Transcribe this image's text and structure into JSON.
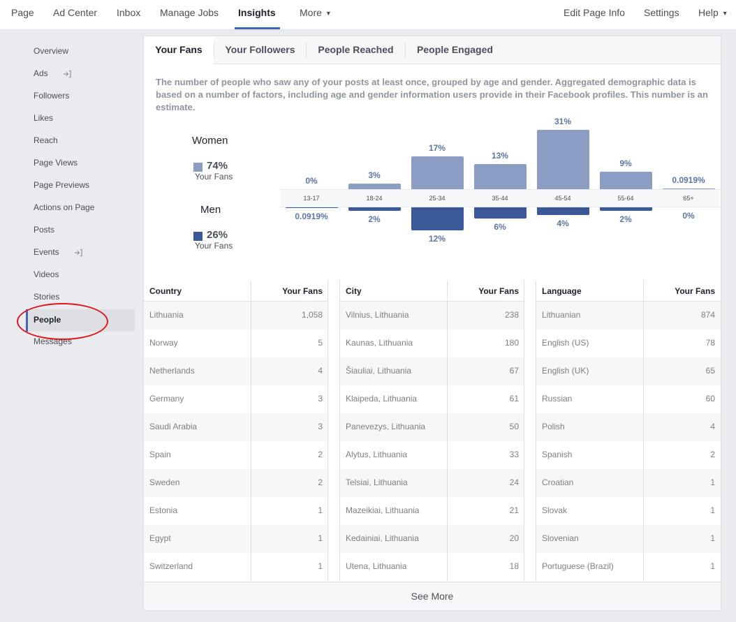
{
  "topnav": {
    "left": [
      "Page",
      "Ad Center",
      "Inbox",
      "Manage Jobs",
      "Insights",
      "More"
    ],
    "right": [
      "Edit Page Info",
      "Settings",
      "Help"
    ],
    "active": "Insights"
  },
  "sidebar": {
    "items": [
      {
        "label": "Overview"
      },
      {
        "label": "Ads",
        "icon": "export-icon"
      },
      {
        "label": "Followers"
      },
      {
        "label": "Likes"
      },
      {
        "label": "Reach"
      },
      {
        "label": "Page Views"
      },
      {
        "label": "Page Previews"
      },
      {
        "label": "Actions on Page"
      },
      {
        "label": "Posts"
      },
      {
        "label": "Events",
        "icon": "export-icon"
      },
      {
        "label": "Videos"
      },
      {
        "label": "Stories"
      },
      {
        "label": "People"
      },
      {
        "label": "Messages"
      }
    ],
    "active": "People"
  },
  "tabs": [
    "Your Fans",
    "Your Followers",
    "People Reached",
    "People Engaged"
  ],
  "description": "The number of people who saw any of your posts at least once, grouped by age and gender. Aggregated demographic data is based on a number of factors, including age and gender information users provide in their Facebook profiles. This number is an estimate.",
  "legend": {
    "women": {
      "label": "Women",
      "pct": "74%",
      "sub": "Your Fans",
      "color": "#8b9dc3"
    },
    "men": {
      "label": "Men",
      "pct": "26%",
      "sub": "Your Fans",
      "color": "#3b5998"
    }
  },
  "chart_data": {
    "type": "bar",
    "categories": [
      "13-17",
      "18-24",
      "25-34",
      "35-44",
      "45-54",
      "55-64",
      "65+"
    ],
    "series": [
      {
        "name": "Women",
        "values": [
          0,
          3,
          17,
          13,
          31,
          9,
          0.0919
        ],
        "labels": [
          "0%",
          "3%",
          "17%",
          "13%",
          "31%",
          "9%",
          "0.0919%"
        ],
        "color": "#8b9dc3"
      },
      {
        "name": "Men",
        "values": [
          0.0919,
          2,
          12,
          6,
          4,
          2,
          0
        ],
        "labels": [
          "0.0919%",
          "2%",
          "12%",
          "6%",
          "4%",
          "2%",
          "0%"
        ],
        "color": "#3b5998"
      }
    ]
  },
  "tables": [
    {
      "headers": [
        "Country",
        "Your Fans"
      ],
      "rows": [
        [
          "Lithuania",
          "1,058"
        ],
        [
          "Norway",
          "5"
        ],
        [
          "Netherlands",
          "4"
        ],
        [
          "Germany",
          "3"
        ],
        [
          "Saudi Arabia",
          "3"
        ],
        [
          "Spain",
          "2"
        ],
        [
          "Sweden",
          "2"
        ],
        [
          "Estonia",
          "1"
        ],
        [
          "Egypt",
          "1"
        ],
        [
          "Switzerland",
          "1"
        ]
      ]
    },
    {
      "headers": [
        "City",
        "Your Fans"
      ],
      "rows": [
        [
          "Vilnius, Lithuania",
          "238"
        ],
        [
          "Kaunas, Lithuania",
          "180"
        ],
        [
          "Šiauliai, Lithuania",
          "67"
        ],
        [
          "Klaipeda, Lithuania",
          "61"
        ],
        [
          "Panevezys, Lithuania",
          "50"
        ],
        [
          "Alytus, Lithuania",
          "33"
        ],
        [
          "Telsiai, Lithuania",
          "24"
        ],
        [
          "Mazeikiai, Lithuania",
          "21"
        ],
        [
          "Kedainiai, Lithuania",
          "20"
        ],
        [
          "Utena, Lithuania",
          "18"
        ]
      ]
    },
    {
      "headers": [
        "Language",
        "Your Fans"
      ],
      "rows": [
        [
          "Lithuanian",
          "874"
        ],
        [
          "English (US)",
          "78"
        ],
        [
          "English (UK)",
          "65"
        ],
        [
          "Russian",
          "60"
        ],
        [
          "Polish",
          "4"
        ],
        [
          "Spanish",
          "2"
        ],
        [
          "Croatian",
          "1"
        ],
        [
          "Slovak",
          "1"
        ],
        [
          "Slovenian",
          "1"
        ],
        [
          "Portuguese (Brazil)",
          "1"
        ]
      ]
    }
  ],
  "see_more": "See More"
}
